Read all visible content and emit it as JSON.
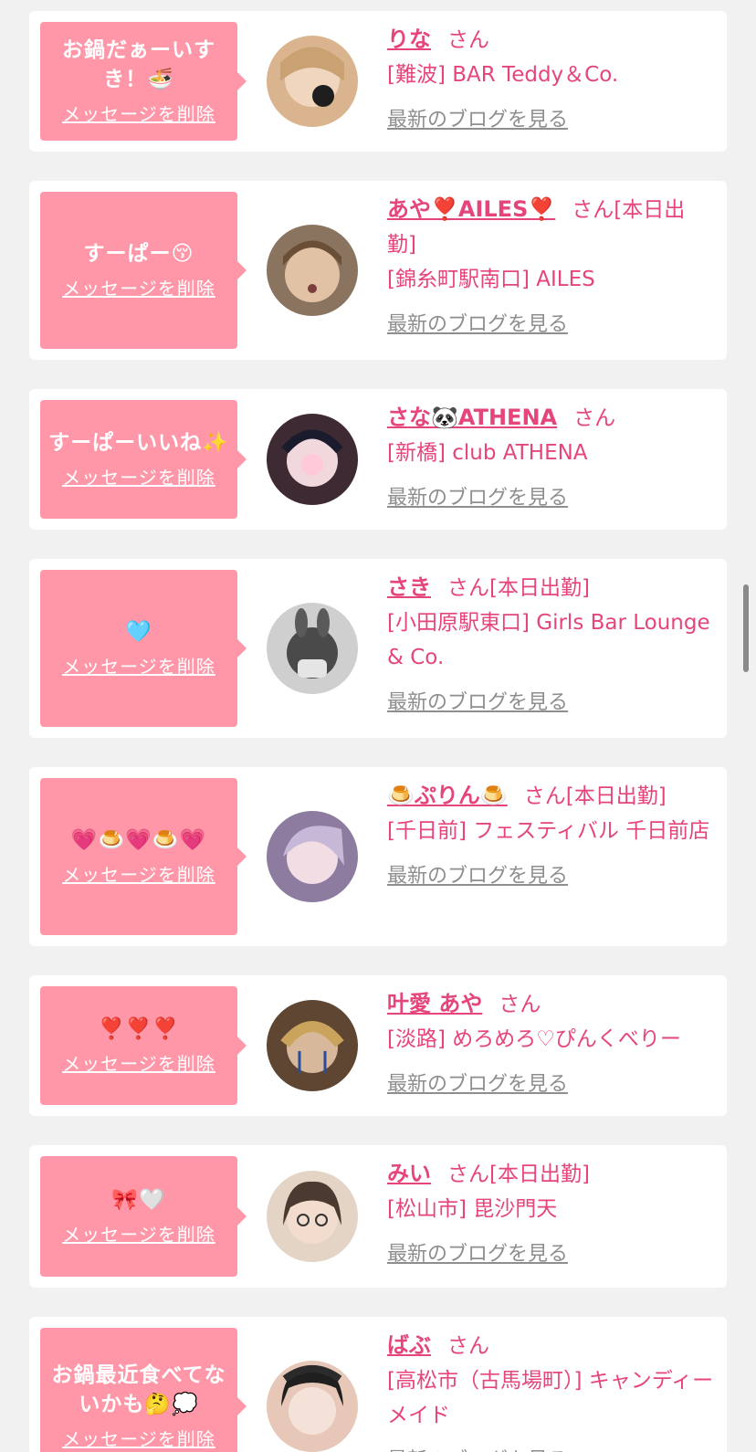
{
  "messages": [
    {
      "message": "お鍋だぁーいすき！🍜",
      "delete_label": "メッセージを削除",
      "name": "りな",
      "suffix": "さん",
      "status": "",
      "shop": "[難波] BAR Teddy＆Co.",
      "blog_label": "最新のブログを見る",
      "avatar_color": "#caa07a"
    },
    {
      "message": "すーぱー😚",
      "delete_label": "メッセージを削除",
      "name": "あや❣️AILES❣️",
      "suffix": "さん",
      "status": "[本日出勤]",
      "shop": "[錦糸町駅南口] AILES",
      "blog_label": "最新のブログを見る",
      "avatar_color": "#b89070"
    },
    {
      "message": "すーぱーいいね✨",
      "delete_label": "メッセージを削除",
      "name": "さな🐼ATHENA",
      "suffix": "さん",
      "status": "",
      "shop": "[新橋] club ATHENA",
      "blog_label": "最新のブログを見る",
      "avatar_color": "#5a3f4a"
    },
    {
      "message": "🩵",
      "delete_label": "メッセージを削除",
      "name": "さき",
      "suffix": "さん",
      "status": "[本日出勤]",
      "shop": "[小田原駅東口] Girls Bar Lounge & Co.",
      "blog_label": "最新のブログを見る",
      "avatar_color": "#6e6e6e"
    },
    {
      "message": "💗🍮💗🍮💗",
      "delete_label": "メッセージを削除",
      "name": "🍮ぷりん🍮",
      "suffix": "さん",
      "status": "[本日出勤]",
      "shop": "[千日前] フェスティバル 千日前店",
      "blog_label": "最新のブログを見る",
      "avatar_color": "#a48fb4"
    },
    {
      "message": "❣️❣️❣️",
      "delete_label": "メッセージを削除",
      "name": "叶愛 あや",
      "suffix": "さん",
      "status": "",
      "shop": "[淡路] めろめろ♡ぴんくべりー",
      "blog_label": "最新のブログを見る",
      "avatar_color": "#7a6048"
    },
    {
      "message": "🎀🤍",
      "delete_label": "メッセージを削除",
      "name": "みい",
      "suffix": "さん",
      "status": "[本日出勤]",
      "shop": "[松山市] 毘沙門天",
      "blog_label": "最新のブログを見る",
      "avatar_color": "#9c8a7a"
    },
    {
      "message": "お鍋最近食べてないかも🤔💭",
      "delete_label": "メッセージを削除",
      "name": "ばぶ",
      "suffix": "さん",
      "status": "",
      "shop": "[高松市（古馬場町）] キャンディーメイド",
      "blog_label": "最新のブログを見る",
      "avatar_color": "#d7b6a6"
    }
  ]
}
